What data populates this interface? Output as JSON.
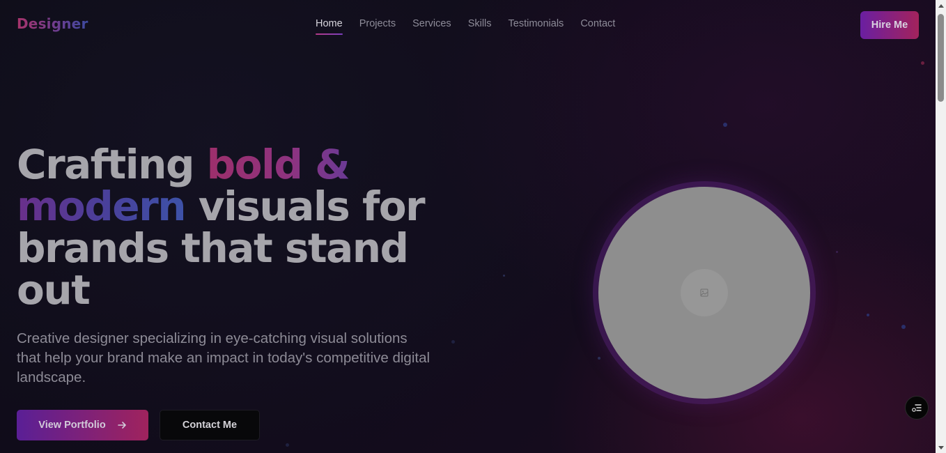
{
  "header": {
    "logo": "Designer",
    "nav": [
      "Home",
      "Projects",
      "Services",
      "Skills",
      "Testimonials",
      "Contact"
    ],
    "active_nav": "Home",
    "hire_label": "Hire Me"
  },
  "hero": {
    "title_part1": "Crafting ",
    "title_highlight1": "bold &",
    "title_highlight2": "modern",
    "title_part2": " visuals for brands that stand out",
    "subtitle": "Creative designer specializing in eye-catching visual solutions that help your brand make an impact in today's competitive digital landscape.",
    "primary_cta": "View Portfolio",
    "secondary_cta": "Contact Me"
  },
  "icons": {
    "cta_arrow": "arrow-right-icon",
    "image_placeholder": "image-icon",
    "floating_widget": "settings-list-icon"
  },
  "colors": {
    "background": "#0e0b16",
    "accent_start": "#6a1fa1",
    "accent_end": "#a3235c",
    "image_placeholder": "#8e8e8e"
  }
}
